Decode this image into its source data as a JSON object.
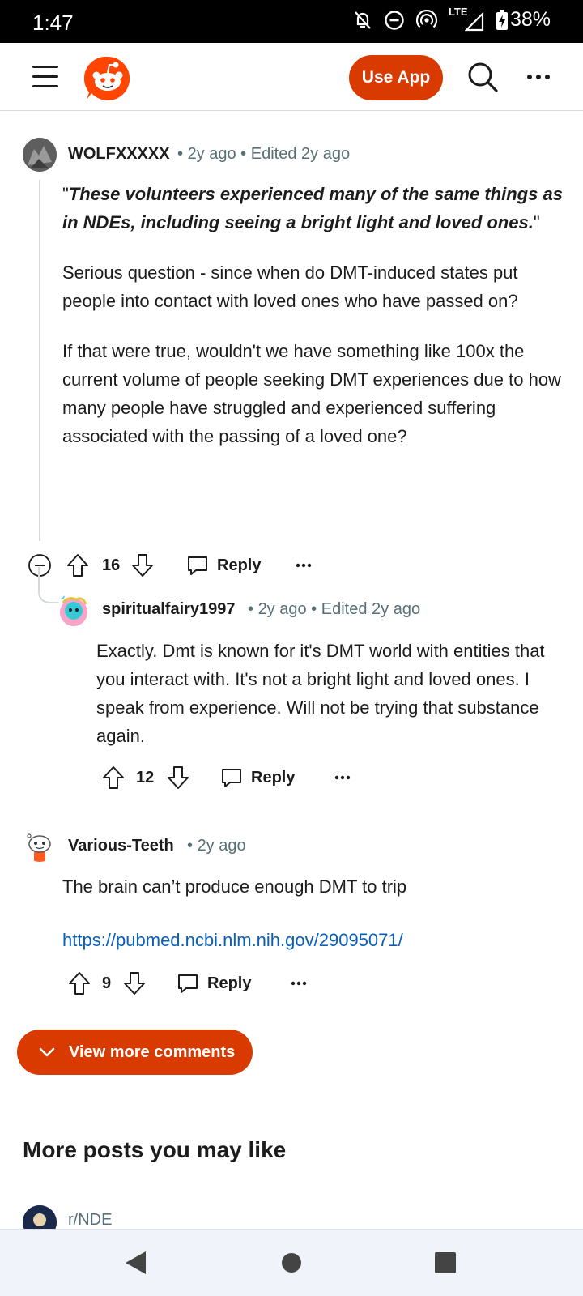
{
  "status_bar": {
    "time": "1:47",
    "network": "LTE",
    "battery": "38%"
  },
  "header": {
    "use_app_label": "Use App"
  },
  "comments": [
    {
      "author": "WOLFXXXXX",
      "time": "2y ago",
      "edited": "Edited 2y ago",
      "quote": "These volunteers experienced many of the same things as in NDEs, including seeing a bright light and loved ones.",
      "paragraphs": [
        "Serious question - since when do DMT-induced states put people into contact with loved ones who have passed on?",
        "If that were true, wouldn't we have something like 100x the current volume of people seeking DMT experiences due to how many people have struggled and experienced suffering associated with the passing of a loved one?"
      ],
      "votes": "16",
      "reply_label": "Reply"
    },
    {
      "author": "spiritualfairy1997",
      "time": "2y ago",
      "edited": "Edited 2y ago",
      "paragraphs": [
        "Exactly. Dmt is known for it's DMT world with entities that you interact with. It's not a bright light and loved ones. I speak from experience. Will not be trying that substance again."
      ],
      "votes": "12",
      "reply_label": "Reply"
    },
    {
      "author": "Various-Teeth",
      "time": "2y ago",
      "paragraphs": [
        "The brain can’t produce enough DMT to trip"
      ],
      "link": "https://pubmed.ncbi.nlm.nih.gov/29095071/",
      "votes": "9",
      "reply_label": "Reply"
    }
  ],
  "view_more_label": "View more comments",
  "more_posts_title": "More posts you may like",
  "suggested_subreddit": "r/NDE",
  "colors": {
    "accent": "#d93a00",
    "link": "#0a5fb8",
    "meta": "#576f76"
  },
  "icons": [
    "menu-icon",
    "reddit-logo-icon",
    "search-icon",
    "more-icon",
    "upvote-icon",
    "downvote-icon",
    "reply-icon",
    "collapse-icon",
    "chevron-down-icon",
    "back-icon",
    "home-icon",
    "recents-icon"
  ]
}
